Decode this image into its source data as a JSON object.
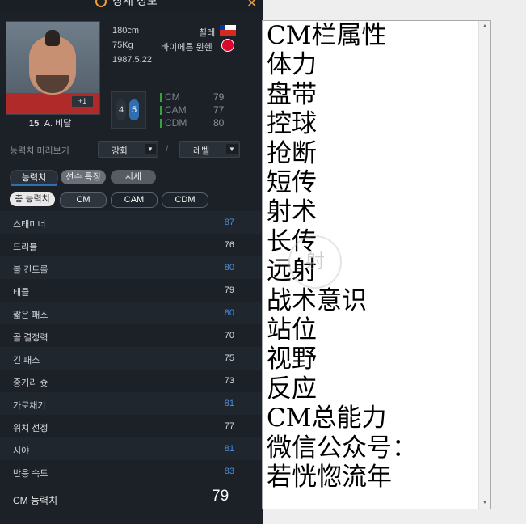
{
  "panel": {
    "title": "상세 정보",
    "close_glyph": "✕"
  },
  "player": {
    "height": "180cm",
    "weight": "75Kg",
    "birth": "1987.5.22",
    "nation": "칠레",
    "club": "바이에른 뮌헨",
    "number": "15",
    "name": "A. 비달",
    "plus_badge": "+1",
    "weak_foot": "4",
    "strong_foot": "5",
    "positions": [
      {
        "name": "CM",
        "value": "79"
      },
      {
        "name": "CAM",
        "value": "77"
      },
      {
        "name": "CDM",
        "value": "80"
      }
    ]
  },
  "preview": {
    "label": "능력치 미리보기",
    "upgrade": "강화",
    "level": "레벨",
    "separator": "/"
  },
  "tabs": [
    "능력치",
    "선수 특징",
    "시세"
  ],
  "filters": [
    "총 능력치",
    "CM",
    "CAM",
    "CDM"
  ],
  "stats": [
    {
      "name": "스태미너",
      "value": "87",
      "color": "blue"
    },
    {
      "name": "드리블",
      "value": "76",
      "color": "white"
    },
    {
      "name": "볼 컨트롤",
      "value": "80",
      "color": "blue"
    },
    {
      "name": "태클",
      "value": "79",
      "color": "white"
    },
    {
      "name": "짧은 패스",
      "value": "80",
      "color": "blue"
    },
    {
      "name": "골 결정력",
      "value": "70",
      "color": "white"
    },
    {
      "name": "긴 패스",
      "value": "75",
      "color": "white"
    },
    {
      "name": "중거리 슛",
      "value": "73",
      "color": "white"
    },
    {
      "name": "가로채기",
      "value": "81",
      "color": "blue"
    },
    {
      "name": "위치 선정",
      "value": "77",
      "color": "white"
    },
    {
      "name": "시야",
      "value": "81",
      "color": "blue"
    },
    {
      "name": "반응 속도",
      "value": "83",
      "color": "blue"
    }
  ],
  "overall": {
    "label": "CM 능력치",
    "value": "79"
  },
  "editor": {
    "lines": [
      "CM栏属性",
      "体力",
      "盘带",
      "控球",
      "抢断",
      "短传",
      "射术",
      "长传",
      "远射",
      "战术意识",
      "站位",
      "视野",
      "反应",
      "CM总能力",
      "微信公众号：",
      "若恍惚流年"
    ]
  },
  "colors": {
    "accent": "#f0a030",
    "stat_blue": "#4a8fd8",
    "position_green": "#3aa23a",
    "panel_bg": "#1c2128"
  },
  "icons": {
    "title": "search-icon",
    "close": "close-icon",
    "dropdown": "triangle-down-icon"
  }
}
